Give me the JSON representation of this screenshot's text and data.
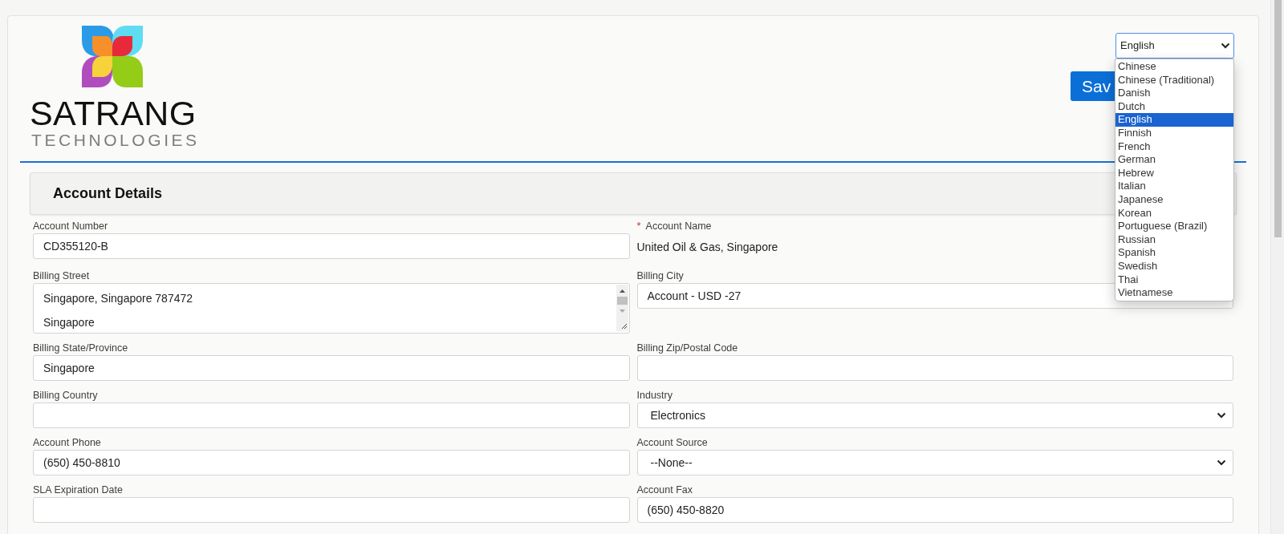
{
  "logo": {
    "name": "SATRANG",
    "tagline": "TECHNOLOGIES"
  },
  "language_select": {
    "value": "English",
    "expanded": true,
    "options": [
      {
        "label": "Chinese",
        "selected": false
      },
      {
        "label": "Chinese (Traditional)",
        "selected": false
      },
      {
        "label": "Danish",
        "selected": false
      },
      {
        "label": "Dutch",
        "selected": false
      },
      {
        "label": "English",
        "selected": true
      },
      {
        "label": "Finnish",
        "selected": false
      },
      {
        "label": "French",
        "selected": false
      },
      {
        "label": "German",
        "selected": false
      },
      {
        "label": "Hebrew",
        "selected": false
      },
      {
        "label": "Italian",
        "selected": false
      },
      {
        "label": "Japanese",
        "selected": false
      },
      {
        "label": "Korean",
        "selected": false
      },
      {
        "label": "Portuguese (Brazil)",
        "selected": false
      },
      {
        "label": "Russian",
        "selected": false
      },
      {
        "label": "Spanish",
        "selected": false
      },
      {
        "label": "Swedish",
        "selected": false
      },
      {
        "label": "Thai",
        "selected": false
      },
      {
        "label": "Vietnamese",
        "selected": false
      }
    ]
  },
  "save_button": {
    "label": "Sav"
  },
  "section": {
    "title": "Account Details"
  },
  "rows": [
    [
      {
        "label": "Account Number",
        "kind": "input",
        "value": "CD355120-B"
      },
      {
        "label": "Account Name",
        "kind": "readonly",
        "required_marker": "*",
        "value": "United Oil & Gas, Singapore"
      }
    ],
    [
      {
        "label": "Billing Street",
        "kind": "textarea",
        "lines": [
          "Singapore, Singapore 787472",
          "Singapore"
        ]
      },
      {
        "label": "Billing City",
        "kind": "input",
        "value": "Account - USD -27"
      }
    ],
    [
      {
        "label": "Billing State/Province",
        "kind": "input",
        "value": "Singapore"
      },
      {
        "label": "Billing Zip/Postal Code",
        "kind": "input"
      }
    ],
    [
      {
        "label": "Billing Country",
        "kind": "input"
      },
      {
        "label": "Industry",
        "kind": "select",
        "value": "Electronics"
      }
    ],
    [
      {
        "label": "Account Phone",
        "kind": "input",
        "value": "(650) 450-8810"
      },
      {
        "label": "Account Source",
        "kind": "select",
        "value": "--None--"
      }
    ],
    [
      {
        "label": "SLA Expiration Date",
        "kind": "input"
      },
      {
        "label": "Account Fax",
        "kind": "input",
        "value": "(650) 450-8820"
      }
    ]
  ]
}
